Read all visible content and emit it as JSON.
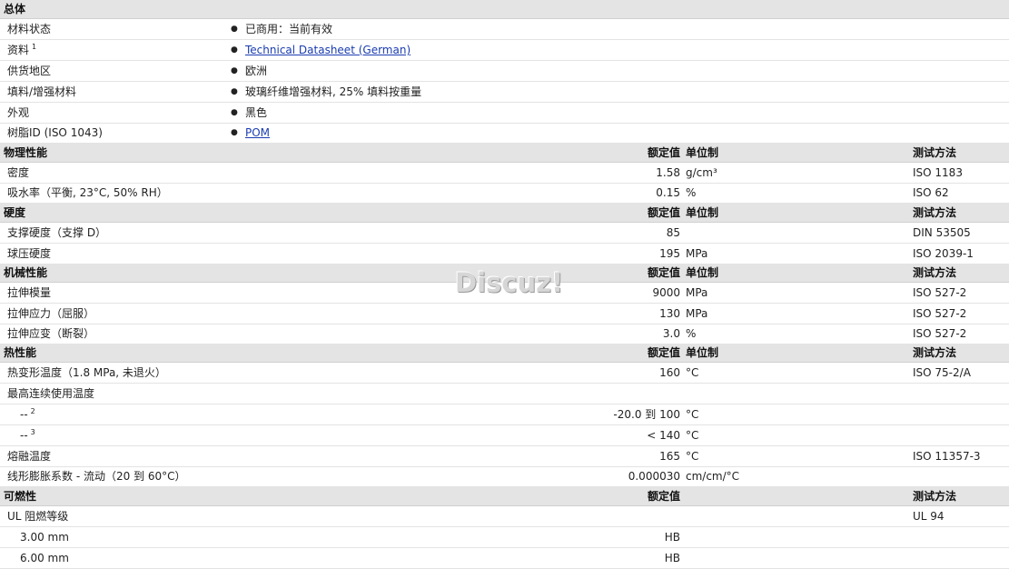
{
  "watermark": "Discuz!",
  "rows": [
    {
      "kind": "header",
      "name": "总体",
      "h": 21
    },
    {
      "kind": "info",
      "name": "材料状态",
      "info": "已商用：当前有效",
      "h": 23
    },
    {
      "kind": "info",
      "name": "资料",
      "sup": "1",
      "info": "Technical Datasheet (German)",
      "link": true,
      "h": 23
    },
    {
      "kind": "info",
      "name": "供货地区",
      "info": "欧洲",
      "h": 23
    },
    {
      "kind": "info",
      "name": "填料/增强材料",
      "info": "玻璃纤维增强材料, 25% 填料按重量",
      "h": 23
    },
    {
      "kind": "info",
      "name": "外观",
      "info": "黑色",
      "h": 23
    },
    {
      "kind": "info",
      "name": "树脂ID (ISO 1043)",
      "info": "POM",
      "link": true,
      "h": 22
    },
    {
      "kind": "header",
      "name": "物理性能",
      "val": "额定值",
      "unit": "单位制",
      "method": "测试方法",
      "h": 21
    },
    {
      "kind": "data",
      "name": "密度",
      "val": "1.58",
      "unit": "g/cm³",
      "method": "ISO 1183",
      "h": 23
    },
    {
      "kind": "data",
      "name": "吸水率（平衡, 23°C, 50% RH）",
      "val": "0.15",
      "unit": "%",
      "method": "ISO 62",
      "h": 22
    },
    {
      "kind": "header",
      "name": "硬度",
      "val": "额定值",
      "unit": "单位制",
      "method": "测试方法",
      "h": 21
    },
    {
      "kind": "data",
      "name": "支撑硬度（支撑 D）",
      "val": "85",
      "unit": "",
      "method": "DIN 53505",
      "h": 23
    },
    {
      "kind": "data",
      "name": "球压硬度",
      "val": "195",
      "unit": "MPa",
      "method": "ISO 2039-1",
      "h": 23
    },
    {
      "kind": "header",
      "name": "机械性能",
      "val": "额定值",
      "unit": "单位制",
      "method": "测试方法",
      "h": 20
    },
    {
      "kind": "data",
      "name": "拉伸模量",
      "val": "9000",
      "unit": "MPa",
      "method": "ISO 527-2",
      "h": 23
    },
    {
      "kind": "data",
      "name": "拉伸应力（屈服）",
      "val": "130",
      "unit": "MPa",
      "method": "ISO 527-2",
      "h": 23
    },
    {
      "kind": "data",
      "name": "拉伸应变（断裂）",
      "val": "3.0",
      "unit": "%",
      "method": "ISO 527-2",
      "h": 22
    },
    {
      "kind": "header",
      "name": "热性能",
      "val": "额定值",
      "unit": "单位制",
      "method": "测试方法",
      "h": 20
    },
    {
      "kind": "data",
      "name": "热变形温度（1.8 MPa, 未退火）",
      "val": "160",
      "unit": "°C",
      "method": "ISO 75-2/A",
      "h": 23
    },
    {
      "kind": "data",
      "name": "最高连续使用温度",
      "val": "",
      "unit": "",
      "method": "",
      "h": 23
    },
    {
      "kind": "data",
      "name": "--",
      "sup": "2",
      "indent": true,
      "val": "-20.0 到  100",
      "unit": "°C",
      "method": "",
      "h": 23
    },
    {
      "kind": "data",
      "name": "--",
      "sup": "3",
      "indent": true,
      "val": "< 140",
      "unit": "°C",
      "method": "",
      "h": 23
    },
    {
      "kind": "data",
      "name": "熔融温度",
      "val": "165",
      "unit": "°C",
      "method": "ISO 11357-3",
      "h": 23
    },
    {
      "kind": "data",
      "name": "线形膨胀系数 - 流动（20 到  60°C）",
      "val": "0.000030",
      "unit": "cm/cm/°C",
      "method": "",
      "h": 22
    },
    {
      "kind": "header",
      "name": "可燃性",
      "val": "额定值",
      "unit": "",
      "method": "测试方法",
      "h": 21
    },
    {
      "kind": "data",
      "name": "UL 阻燃等级",
      "val": "",
      "unit": "",
      "method": "UL 94",
      "h": 23
    },
    {
      "kind": "data",
      "name": "3.00 mm",
      "indent": true,
      "val": "HB",
      "unit": "",
      "method": "",
      "h": 23
    },
    {
      "kind": "data",
      "name": "6.00 mm",
      "indent": true,
      "val": "HB",
      "unit": "",
      "method": "",
      "h": 23
    }
  ]
}
